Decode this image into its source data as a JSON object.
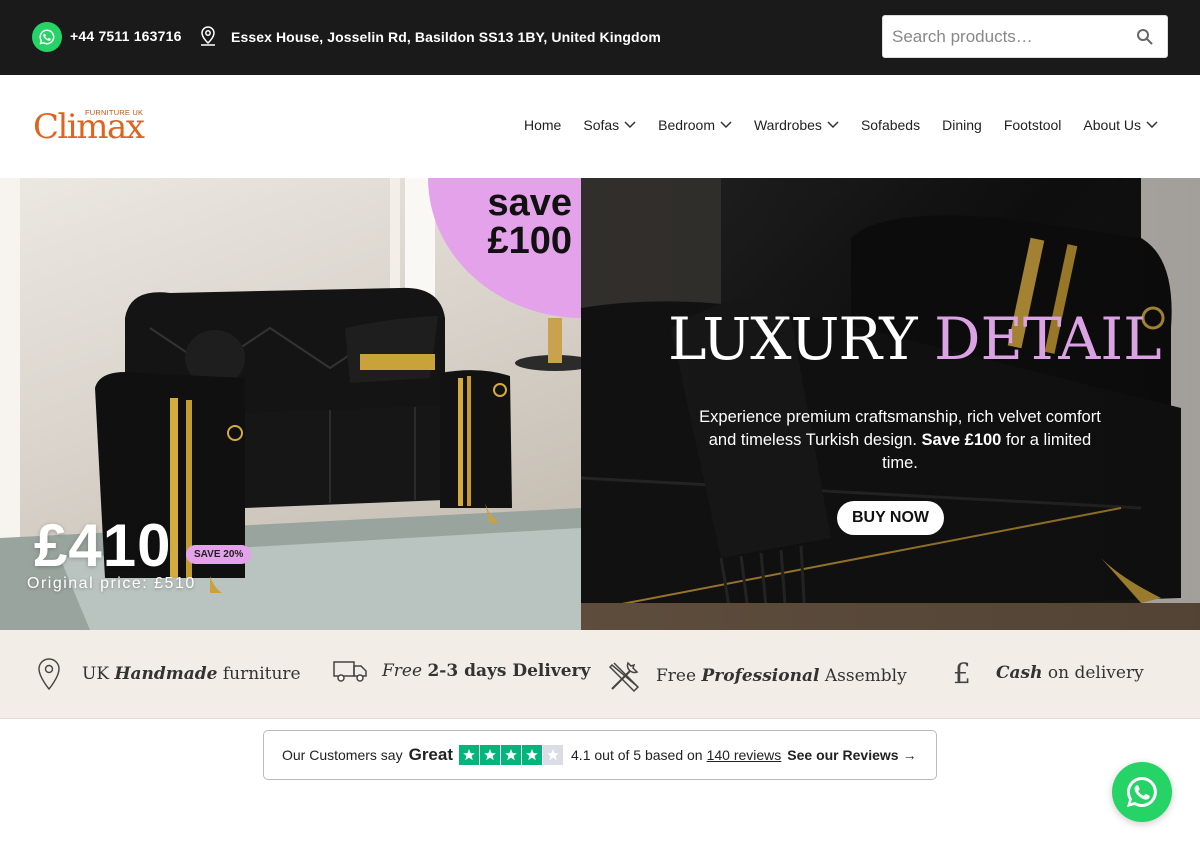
{
  "topbar": {
    "phone": "+44 7511 163716",
    "address": "Essex House, Josselin Rd, Basildon SS13 1BY, United Kingdom",
    "search_placeholder": "Search products…"
  },
  "logo": {
    "small": "FURNITURE UK",
    "big": "Climax"
  },
  "nav": {
    "home": "Home",
    "sofas": "Sofas",
    "bedroom": "Bedroom",
    "wardrobes": "Wardrobes",
    "sofabeds": "Sofabeds",
    "dining": "Dining",
    "footstool": "Footstool",
    "about": "About Us"
  },
  "hero": {
    "save_word": "save",
    "save_amount": "£100",
    "price": "£410",
    "save_badge": "SAVE 20%",
    "original_price": "Original price: £510",
    "title_part1": "LUXURY",
    "title_part2": "DETAIL",
    "desc_1": "Experience premium craftsmanship, rich velvet comfort and timeless Turkish design.",
    "desc_bold": "Save £100",
    "desc_2": "for a limited time.",
    "buy_label": "BUY NOW"
  },
  "features": {
    "f1_a": "UK",
    "f1_b": "Handmade",
    "f1_c": "furniture",
    "f2_a": "Free",
    "f2_b": "2-3 days Delivery",
    "f3_a": "Free",
    "f3_b": "Professional",
    "f3_c": "Assembly",
    "f4_a": "Cash",
    "f4_b": "on delivery"
  },
  "reviews": {
    "prefix": "Our Customers say",
    "rating_word": "Great",
    "stars_rating": 4.1,
    "score_text": "4.1 out of 5 based on",
    "reviews_link": "140 reviews",
    "see_link": "See our Reviews",
    "arrow": "→"
  },
  "colors": {
    "topbar_bg": "#1a1a1a",
    "brand_orange": "#e0641f",
    "accent_pink": "#e3a2ea",
    "features_bg": "#f2ede6",
    "trustpilot_green": "#00b67a",
    "whatsapp_green": "#25d366"
  },
  "icons": {
    "whatsapp": "whatsapp-icon",
    "location": "location-pin-icon",
    "search": "search-icon",
    "chevron": "chevron-down-icon",
    "truck": "truck-icon",
    "tools": "tools-icon",
    "pound": "pound-icon",
    "star": "star-icon"
  }
}
